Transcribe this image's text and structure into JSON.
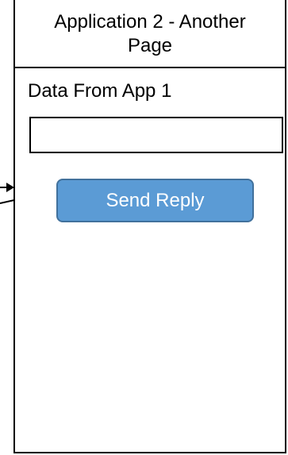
{
  "window": {
    "title": "Application 2 - Another Page"
  },
  "form": {
    "label": "Data From App 1",
    "input_value": "",
    "input_placeholder": ""
  },
  "actions": {
    "send_reply_label": "Send Reply"
  },
  "colors": {
    "button_fill": "#5b9bd5",
    "button_border": "#41719c",
    "button_text": "#ffffff",
    "outline": "#000000"
  }
}
